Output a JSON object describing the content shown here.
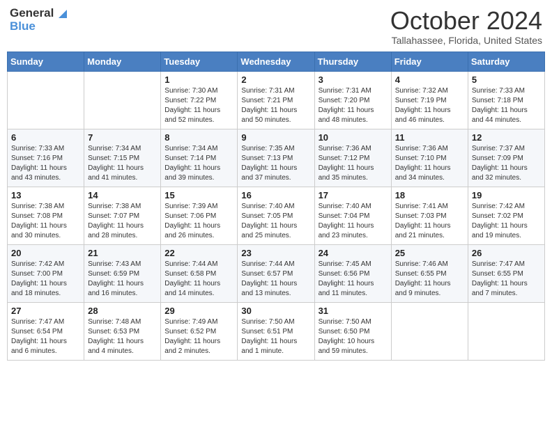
{
  "header": {
    "logo_line1": "General",
    "logo_line2": "Blue",
    "month_title": "October 2024",
    "location": "Tallahassee, Florida, United States"
  },
  "weekdays": [
    "Sunday",
    "Monday",
    "Tuesday",
    "Wednesday",
    "Thursday",
    "Friday",
    "Saturday"
  ],
  "weeks": [
    [
      {
        "day": "",
        "info": ""
      },
      {
        "day": "",
        "info": ""
      },
      {
        "day": "1",
        "info": "Sunrise: 7:30 AM\nSunset: 7:22 PM\nDaylight: 11 hours and 52 minutes."
      },
      {
        "day": "2",
        "info": "Sunrise: 7:31 AM\nSunset: 7:21 PM\nDaylight: 11 hours and 50 minutes."
      },
      {
        "day": "3",
        "info": "Sunrise: 7:31 AM\nSunset: 7:20 PM\nDaylight: 11 hours and 48 minutes."
      },
      {
        "day": "4",
        "info": "Sunrise: 7:32 AM\nSunset: 7:19 PM\nDaylight: 11 hours and 46 minutes."
      },
      {
        "day": "5",
        "info": "Sunrise: 7:33 AM\nSunset: 7:18 PM\nDaylight: 11 hours and 44 minutes."
      }
    ],
    [
      {
        "day": "6",
        "info": "Sunrise: 7:33 AM\nSunset: 7:16 PM\nDaylight: 11 hours and 43 minutes."
      },
      {
        "day": "7",
        "info": "Sunrise: 7:34 AM\nSunset: 7:15 PM\nDaylight: 11 hours and 41 minutes."
      },
      {
        "day": "8",
        "info": "Sunrise: 7:34 AM\nSunset: 7:14 PM\nDaylight: 11 hours and 39 minutes."
      },
      {
        "day": "9",
        "info": "Sunrise: 7:35 AM\nSunset: 7:13 PM\nDaylight: 11 hours and 37 minutes."
      },
      {
        "day": "10",
        "info": "Sunrise: 7:36 AM\nSunset: 7:12 PM\nDaylight: 11 hours and 35 minutes."
      },
      {
        "day": "11",
        "info": "Sunrise: 7:36 AM\nSunset: 7:10 PM\nDaylight: 11 hours and 34 minutes."
      },
      {
        "day": "12",
        "info": "Sunrise: 7:37 AM\nSunset: 7:09 PM\nDaylight: 11 hours and 32 minutes."
      }
    ],
    [
      {
        "day": "13",
        "info": "Sunrise: 7:38 AM\nSunset: 7:08 PM\nDaylight: 11 hours and 30 minutes."
      },
      {
        "day": "14",
        "info": "Sunrise: 7:38 AM\nSunset: 7:07 PM\nDaylight: 11 hours and 28 minutes."
      },
      {
        "day": "15",
        "info": "Sunrise: 7:39 AM\nSunset: 7:06 PM\nDaylight: 11 hours and 26 minutes."
      },
      {
        "day": "16",
        "info": "Sunrise: 7:40 AM\nSunset: 7:05 PM\nDaylight: 11 hours and 25 minutes."
      },
      {
        "day": "17",
        "info": "Sunrise: 7:40 AM\nSunset: 7:04 PM\nDaylight: 11 hours and 23 minutes."
      },
      {
        "day": "18",
        "info": "Sunrise: 7:41 AM\nSunset: 7:03 PM\nDaylight: 11 hours and 21 minutes."
      },
      {
        "day": "19",
        "info": "Sunrise: 7:42 AM\nSunset: 7:02 PM\nDaylight: 11 hours and 19 minutes."
      }
    ],
    [
      {
        "day": "20",
        "info": "Sunrise: 7:42 AM\nSunset: 7:00 PM\nDaylight: 11 hours and 18 minutes."
      },
      {
        "day": "21",
        "info": "Sunrise: 7:43 AM\nSunset: 6:59 PM\nDaylight: 11 hours and 16 minutes."
      },
      {
        "day": "22",
        "info": "Sunrise: 7:44 AM\nSunset: 6:58 PM\nDaylight: 11 hours and 14 minutes."
      },
      {
        "day": "23",
        "info": "Sunrise: 7:44 AM\nSunset: 6:57 PM\nDaylight: 11 hours and 13 minutes."
      },
      {
        "day": "24",
        "info": "Sunrise: 7:45 AM\nSunset: 6:56 PM\nDaylight: 11 hours and 11 minutes."
      },
      {
        "day": "25",
        "info": "Sunrise: 7:46 AM\nSunset: 6:55 PM\nDaylight: 11 hours and 9 minutes."
      },
      {
        "day": "26",
        "info": "Sunrise: 7:47 AM\nSunset: 6:55 PM\nDaylight: 11 hours and 7 minutes."
      }
    ],
    [
      {
        "day": "27",
        "info": "Sunrise: 7:47 AM\nSunset: 6:54 PM\nDaylight: 11 hours and 6 minutes."
      },
      {
        "day": "28",
        "info": "Sunrise: 7:48 AM\nSunset: 6:53 PM\nDaylight: 11 hours and 4 minutes."
      },
      {
        "day": "29",
        "info": "Sunrise: 7:49 AM\nSunset: 6:52 PM\nDaylight: 11 hours and 2 minutes."
      },
      {
        "day": "30",
        "info": "Sunrise: 7:50 AM\nSunset: 6:51 PM\nDaylight: 11 hours and 1 minute."
      },
      {
        "day": "31",
        "info": "Sunrise: 7:50 AM\nSunset: 6:50 PM\nDaylight: 10 hours and 59 minutes."
      },
      {
        "day": "",
        "info": ""
      },
      {
        "day": "",
        "info": ""
      }
    ]
  ]
}
